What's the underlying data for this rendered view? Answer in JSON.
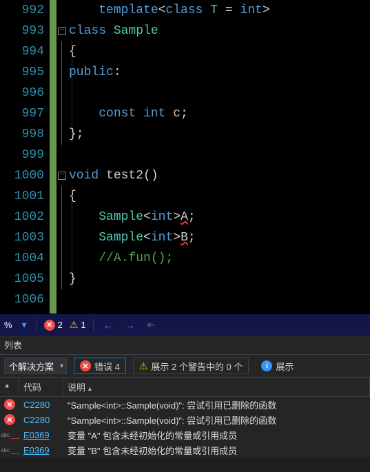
{
  "editor": {
    "lines": [
      {
        "num": "992",
        "html": "<span class='kw'>template</span><span class='punct'>&lt;</span><span class='kw'>class</span> <span class='type'>T</span> <span class='punct'>=</span> <span class='kw'>int</span><span class='punct'>&gt;</span>",
        "indent": 1
      },
      {
        "num": "993",
        "html": "<span class='kw'>class</span> <span class='type'>Sample</span>",
        "indent": 0,
        "fold": true
      },
      {
        "num": "994",
        "html": "<span class='punct'>{</span>",
        "indent": 0
      },
      {
        "num": "995",
        "html": "<span class='kw'>public</span><span class='punct'>:</span>",
        "indent": 0
      },
      {
        "num": "996",
        "html": "",
        "indent": 0
      },
      {
        "num": "997",
        "html": "    <span class='kw'>const</span> <span class='kw'>int</span> <span class='var'>c</span><span class='punct'>;</span>",
        "indent": 0
      },
      {
        "num": "998",
        "html": "<span class='punct'>};</span>",
        "indent": 0
      },
      {
        "num": "999",
        "html": "",
        "indent": 0
      },
      {
        "num": "1000",
        "html": "<span class='kw'>void</span> <span class='var'>test2</span><span class='punct'>()</span>",
        "indent": 0,
        "fold": true
      },
      {
        "num": "1001",
        "html": "<span class='punct'>{</span>",
        "indent": 0
      },
      {
        "num": "1002",
        "html": "    <span class='type'>Sample</span><span class='punct'>&lt;</span><span class='kw'>int</span><span class='punct'>&gt;</span><span class='var underline-err'>A</span><span class='punct'>;</span>",
        "indent": 0
      },
      {
        "num": "1003",
        "html": "    <span class='type'>Sample</span><span class='punct'>&lt;</span><span class='kw'>int</span><span class='punct'>&gt;</span><span class='var underline-err'>B</span><span class='punct'>;</span>",
        "indent": 0
      },
      {
        "num": "1004",
        "html": "    <span class='comment'>//A.fun();</span>",
        "indent": 0
      },
      {
        "num": "1005",
        "html": "<span class='punct'>}</span>",
        "indent": 0
      },
      {
        "num": "1006",
        "html": "",
        "indent": 0
      }
    ]
  },
  "statusbar": {
    "percent": "%",
    "errors": "2",
    "warnings": "1"
  },
  "panel": {
    "title": "列表",
    "scope": "个解决方案",
    "errors_btn": "错误 4",
    "warnings_btn": "展示 2 个警告中的 0 个",
    "info_btn": "展示",
    "col_code": "代码",
    "col_desc": "说明",
    "rows": [
      {
        "icon": "error",
        "code": "C2280",
        "desc": "\"Sample<int>::Sample(void)\": 尝试引用已删除的函数",
        "link": false
      },
      {
        "icon": "error",
        "code": "C2280",
        "desc": "\"Sample<int>::Sample(void)\": 尝试引用已删除的函数",
        "link": false
      },
      {
        "icon": "abcwavy",
        "code": "E0369",
        "desc": "变量 \"A\" 包含未经初始化的常量或引用成员",
        "link": true
      },
      {
        "icon": "abcwavy",
        "code": "E0369",
        "desc": "变量 \"B\" 包含未经初始化的常量或引用成员",
        "link": true
      }
    ]
  }
}
